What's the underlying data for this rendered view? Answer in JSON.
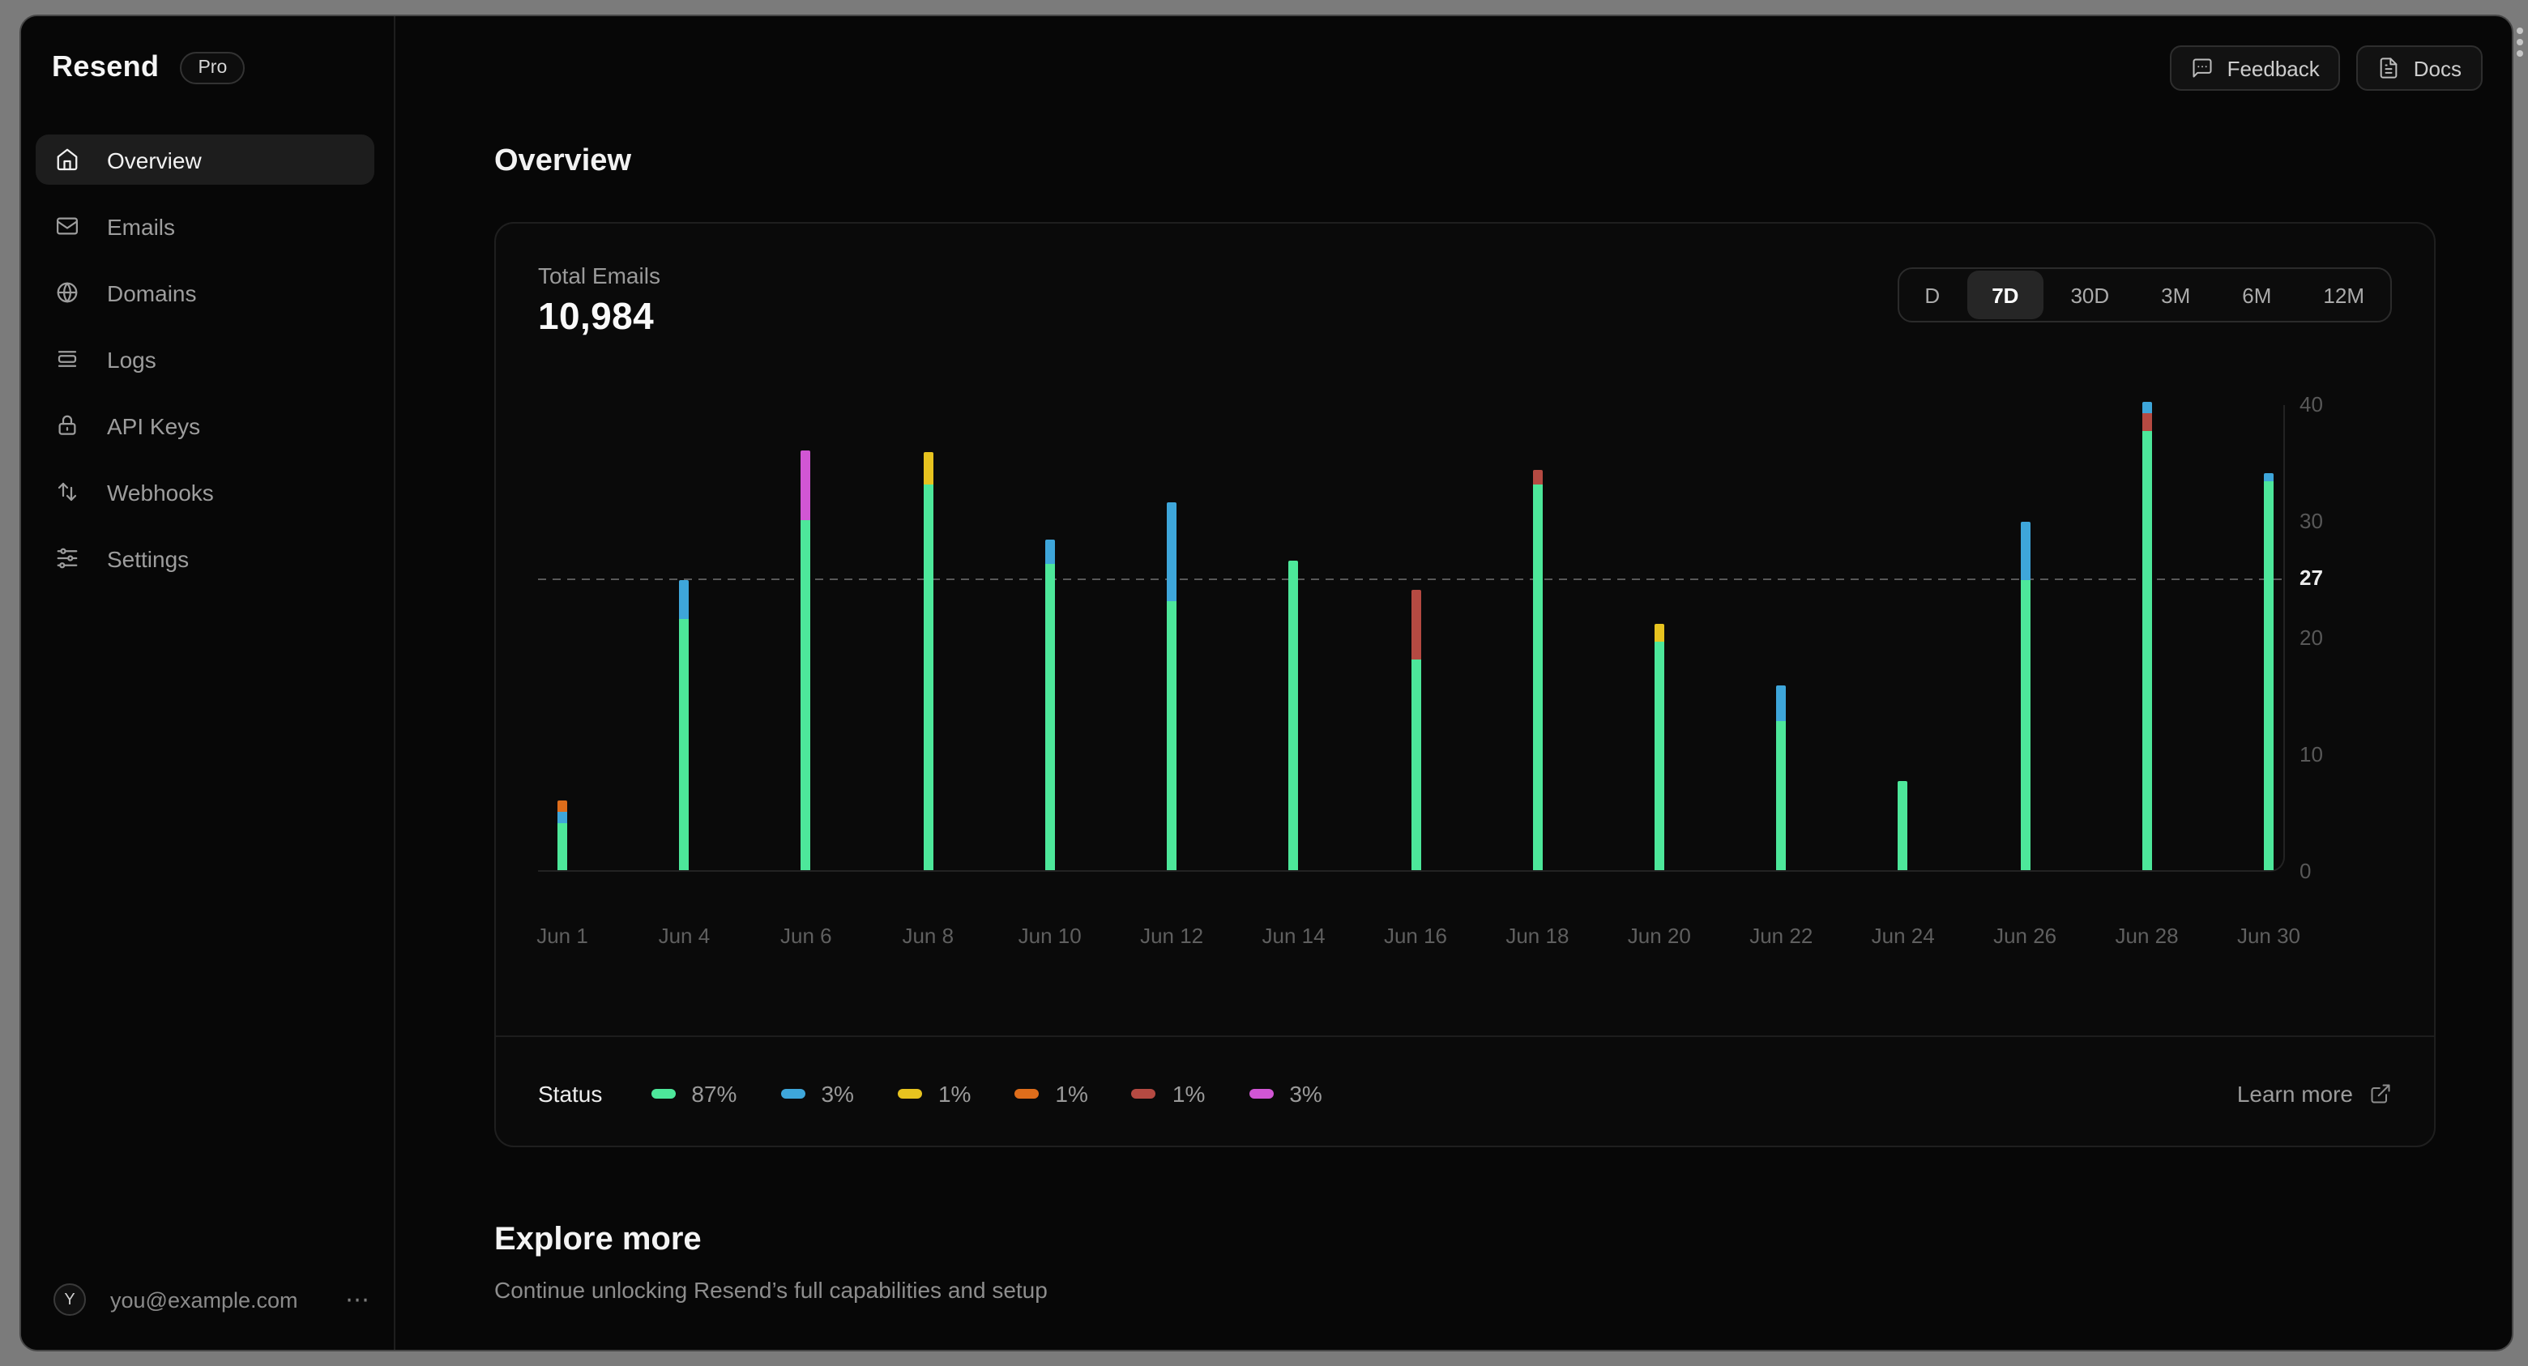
{
  "sidebar": {
    "logo": "Resend",
    "badge": "Pro",
    "items": [
      {
        "label": "Overview",
        "icon": "home-icon",
        "active": true
      },
      {
        "label": "Emails",
        "icon": "mail-icon",
        "active": false
      },
      {
        "label": "Domains",
        "icon": "globe-icon",
        "active": false
      },
      {
        "label": "Logs",
        "icon": "logs-icon",
        "active": false
      },
      {
        "label": "API Keys",
        "icon": "lock-icon",
        "active": false
      },
      {
        "label": "Webhooks",
        "icon": "arrows-up-down-icon",
        "active": false
      },
      {
        "label": "Settings",
        "icon": "sliders-icon",
        "active": false
      }
    ],
    "user": {
      "avatar_initial": "Y",
      "email": "you@example.com",
      "menu": "⋯"
    }
  },
  "header": {
    "buttons": [
      {
        "label": "Feedback",
        "icon": "speech-bubble-icon"
      },
      {
        "label": "Docs",
        "icon": "document-icon"
      }
    ]
  },
  "page": {
    "title": "Overview"
  },
  "card": {
    "metric_label": "Total Emails",
    "metric_value": "10,984",
    "ranges": [
      {
        "label": "D",
        "active": false
      },
      {
        "label": "7D",
        "active": true
      },
      {
        "label": "30D",
        "active": false
      },
      {
        "label": "3M",
        "active": false
      },
      {
        "label": "6M",
        "active": false
      },
      {
        "label": "12M",
        "active": false
      }
    ],
    "learn_more": "Learn more"
  },
  "chart_data": {
    "type": "bar",
    "title": "Total Emails",
    "stacked": true,
    "ylim": [
      0,
      40
    ],
    "y_ticks": [
      0,
      10,
      20,
      30,
      40
    ],
    "grid": "off",
    "legend_position": "bottom-left",
    "reference_line": {
      "value": 27,
      "label": "27",
      "style": "dashed"
    },
    "colors": {
      "green": "#4de79a",
      "blue": "#3ea6da",
      "yellow": "#e7c31f",
      "orange": "#de6d1b",
      "red": "#b54a42",
      "magenta": "#d156d4"
    },
    "categories": [
      "Jun 1",
      "Jun 4",
      "Jun 6",
      "Jun 8",
      "Jun 10",
      "Jun 12",
      "Jun 14",
      "Jun 16",
      "Jun 18",
      "Jun 20",
      "Jun 22",
      "Jun 24",
      "Jun 26",
      "Jun 28",
      "Jun 30"
    ],
    "bars": [
      {
        "label": "Jun 1",
        "total": 6,
        "segments": [
          {
            "status": "green",
            "value": 4
          },
          {
            "status": "blue",
            "value": 1
          },
          {
            "status": "orange",
            "value": 1,
            "pattern": "dotted"
          }
        ]
      },
      {
        "label": "Jun 4",
        "total": 24.8,
        "segments": [
          {
            "status": "green",
            "value": 21.5
          },
          {
            "status": "blue",
            "value": 3.3
          }
        ]
      },
      {
        "label": "Jun 6",
        "total": 36,
        "segments": [
          {
            "status": "green",
            "value": 30
          },
          {
            "status": "magenta",
            "value": 6
          }
        ]
      },
      {
        "label": "Jun 8",
        "total": 35.8,
        "segments": [
          {
            "status": "green",
            "value": 33
          },
          {
            "status": "yellow",
            "value": 2.8
          }
        ]
      },
      {
        "label": "Jun 10",
        "total": 28.3,
        "segments": [
          {
            "status": "green",
            "value": 26.3
          },
          {
            "status": "blue",
            "value": 2
          }
        ]
      },
      {
        "label": "Jun 12",
        "total": 31.5,
        "segments": [
          {
            "status": "green",
            "value": 23
          },
          {
            "status": "blue",
            "value": 8.5
          }
        ]
      },
      {
        "label": "Jun 14",
        "total": 26.5,
        "segments": [
          {
            "status": "green",
            "value": 26.5
          }
        ]
      },
      {
        "label": "Jun 16",
        "total": 24,
        "segments": [
          {
            "status": "green",
            "value": 18
          },
          {
            "status": "red",
            "value": 6
          }
        ]
      },
      {
        "label": "Jun 18",
        "total": 34.3,
        "segments": [
          {
            "status": "green",
            "value": 33
          },
          {
            "status": "red",
            "value": 1.3
          }
        ]
      },
      {
        "label": "Jun 20",
        "total": 21.1,
        "segments": [
          {
            "status": "green",
            "value": 19.6
          },
          {
            "status": "yellow",
            "value": 1.5
          }
        ]
      },
      {
        "label": "Jun 22",
        "total": 15.9,
        "segments": [
          {
            "status": "green",
            "value": 12.8
          },
          {
            "status": "blue",
            "value": 3.1
          }
        ]
      },
      {
        "label": "Jun 24",
        "total": 7.6,
        "segments": [
          {
            "status": "green",
            "value": 7.6
          }
        ]
      },
      {
        "label": "Jun 26",
        "total": 29.9,
        "segments": [
          {
            "status": "green",
            "value": 24.8
          },
          {
            "status": "blue",
            "value": 5.1
          }
        ]
      },
      {
        "label": "Jun 28",
        "total": 40.1,
        "segments": [
          {
            "status": "green",
            "value": 37.6
          },
          {
            "status": "red",
            "value": 1.5
          },
          {
            "status": "blue",
            "value": 1
          }
        ]
      },
      {
        "label": "Jun 30",
        "total": 34.1,
        "segments": [
          {
            "status": "green",
            "value": 33.3
          },
          {
            "status": "blue",
            "value": 0.8
          }
        ]
      }
    ],
    "legend": {
      "title": "Status",
      "items": [
        {
          "status": "green",
          "percent": "87%"
        },
        {
          "status": "blue",
          "percent": "3%"
        },
        {
          "status": "yellow",
          "percent": "1%"
        },
        {
          "status": "orange",
          "percent": "1%",
          "pattern": "dotted"
        },
        {
          "status": "red",
          "percent": "1%"
        },
        {
          "status": "magenta",
          "percent": "3%"
        }
      ]
    }
  },
  "explore": {
    "title": "Explore more",
    "subtitle": "Continue unlocking Resend’s full capabilities and setup"
  }
}
